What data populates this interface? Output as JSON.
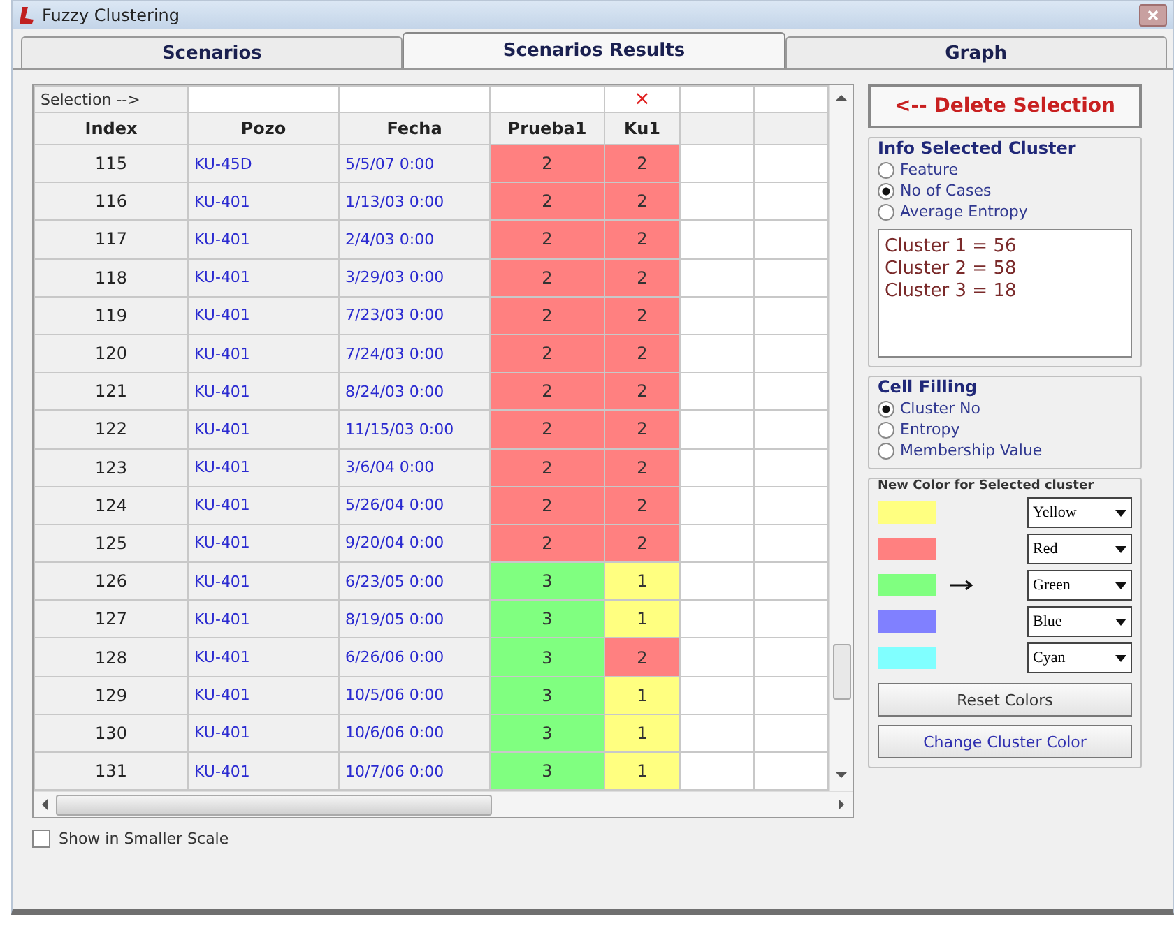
{
  "window": {
    "title": "Fuzzy Clustering"
  },
  "tabs": [
    {
      "label": "Scenarios",
      "selected": false
    },
    {
      "label": "Scenarios Results",
      "selected": true
    },
    {
      "label": "Graph",
      "selected": false
    }
  ],
  "table": {
    "selection_label": "Selection -->",
    "columns": [
      {
        "label": "Index"
      },
      {
        "label": "Pozo"
      },
      {
        "label": "Fecha"
      },
      {
        "label": "Prueba1"
      },
      {
        "label": "Ku1",
        "selection_mark": "×"
      }
    ],
    "rows": [
      {
        "index": "115",
        "pozo": "KU-45D",
        "fecha": "5/5/07 0:00",
        "prueba1": {
          "value": "2",
          "color": "#ff8080"
        },
        "ku1": {
          "value": "2",
          "color": "#ff8080"
        }
      },
      {
        "index": "116",
        "pozo": "KU-401",
        "fecha": "1/13/03 0:00",
        "prueba1": {
          "value": "2",
          "color": "#ff8080"
        },
        "ku1": {
          "value": "2",
          "color": "#ff8080"
        }
      },
      {
        "index": "117",
        "pozo": "KU-401",
        "fecha": "2/4/03 0:00",
        "prueba1": {
          "value": "2",
          "color": "#ff8080"
        },
        "ku1": {
          "value": "2",
          "color": "#ff8080"
        }
      },
      {
        "index": "118",
        "pozo": "KU-401",
        "fecha": "3/29/03 0:00",
        "prueba1": {
          "value": "2",
          "color": "#ff8080"
        },
        "ku1": {
          "value": "2",
          "color": "#ff8080"
        }
      },
      {
        "index": "119",
        "pozo": "KU-401",
        "fecha": "7/23/03 0:00",
        "prueba1": {
          "value": "2",
          "color": "#ff8080"
        },
        "ku1": {
          "value": "2",
          "color": "#ff8080"
        }
      },
      {
        "index": "120",
        "pozo": "KU-401",
        "fecha": "7/24/03 0:00",
        "prueba1": {
          "value": "2",
          "color": "#ff8080"
        },
        "ku1": {
          "value": "2",
          "color": "#ff8080"
        }
      },
      {
        "index": "121",
        "pozo": "KU-401",
        "fecha": "8/24/03 0:00",
        "prueba1": {
          "value": "2",
          "color": "#ff8080"
        },
        "ku1": {
          "value": "2",
          "color": "#ff8080"
        }
      },
      {
        "index": "122",
        "pozo": "KU-401",
        "fecha": "11/15/03 0:00",
        "prueba1": {
          "value": "2",
          "color": "#ff8080"
        },
        "ku1": {
          "value": "2",
          "color": "#ff8080"
        }
      },
      {
        "index": "123",
        "pozo": "KU-401",
        "fecha": "3/6/04 0:00",
        "prueba1": {
          "value": "2",
          "color": "#ff8080"
        },
        "ku1": {
          "value": "2",
          "color": "#ff8080"
        }
      },
      {
        "index": "124",
        "pozo": "KU-401",
        "fecha": "5/26/04 0:00",
        "prueba1": {
          "value": "2",
          "color": "#ff8080"
        },
        "ku1": {
          "value": "2",
          "color": "#ff8080"
        }
      },
      {
        "index": "125",
        "pozo": "KU-401",
        "fecha": "9/20/04 0:00",
        "prueba1": {
          "value": "2",
          "color": "#ff8080"
        },
        "ku1": {
          "value": "2",
          "color": "#ff8080"
        }
      },
      {
        "index": "126",
        "pozo": "KU-401",
        "fecha": "6/23/05 0:00",
        "prueba1": {
          "value": "3",
          "color": "#80ff80"
        },
        "ku1": {
          "value": "1",
          "color": "#ffff80"
        }
      },
      {
        "index": "127",
        "pozo": "KU-401",
        "fecha": "8/19/05 0:00",
        "prueba1": {
          "value": "3",
          "color": "#80ff80"
        },
        "ku1": {
          "value": "1",
          "color": "#ffff80"
        }
      },
      {
        "index": "128",
        "pozo": "KU-401",
        "fecha": "6/26/06 0:00",
        "prueba1": {
          "value": "3",
          "color": "#80ff80"
        },
        "ku1": {
          "value": "2",
          "color": "#ff8080"
        }
      },
      {
        "index": "129",
        "pozo": "KU-401",
        "fecha": "10/5/06 0:00",
        "prueba1": {
          "value": "3",
          "color": "#80ff80"
        },
        "ku1": {
          "value": "1",
          "color": "#ffff80"
        }
      },
      {
        "index": "130",
        "pozo": "KU-401",
        "fecha": "10/6/06 0:00",
        "prueba1": {
          "value": "3",
          "color": "#80ff80"
        },
        "ku1": {
          "value": "1",
          "color": "#ffff80"
        }
      },
      {
        "index": "131",
        "pozo": "KU-401",
        "fecha": "10/7/06 0:00",
        "prueba1": {
          "value": "3",
          "color": "#80ff80"
        },
        "ku1": {
          "value": "1",
          "color": "#ffff80"
        }
      }
    ]
  },
  "show_smaller_scale": {
    "label": "Show in Smaller Scale",
    "checked": false
  },
  "delete_button": "<-- Delete Selection",
  "info_group": {
    "title": "Info Selected Cluster",
    "options": [
      {
        "label": "Feature",
        "selected": false
      },
      {
        "label": "No of Cases",
        "selected": true
      },
      {
        "label": "Average  Entropy",
        "selected": false
      }
    ],
    "results": [
      "Cluster 1 = 56",
      "Cluster 2 = 58",
      "Cluster 3 = 18"
    ]
  },
  "cell_filling": {
    "title": "Cell Filling",
    "options": [
      {
        "label": "Cluster No",
        "selected": true
      },
      {
        "label": "Entropy",
        "selected": false
      },
      {
        "label": "Membership Value",
        "selected": false
      }
    ]
  },
  "color_group": {
    "title": "New Color for Selected cluster",
    "colors": [
      {
        "color": "#ffff80",
        "name": "Yellow",
        "selected": false
      },
      {
        "color": "#ff8080",
        "name": "Red",
        "selected": false
      },
      {
        "color": "#80ff80",
        "name": "Green",
        "selected": true
      },
      {
        "color": "#8080ff",
        "name": "Blue",
        "selected": false
      },
      {
        "color": "#80ffff",
        "name": "Cyan",
        "selected": false
      }
    ],
    "reset_button": "Reset Colors",
    "change_button": "Change Cluster Color"
  }
}
